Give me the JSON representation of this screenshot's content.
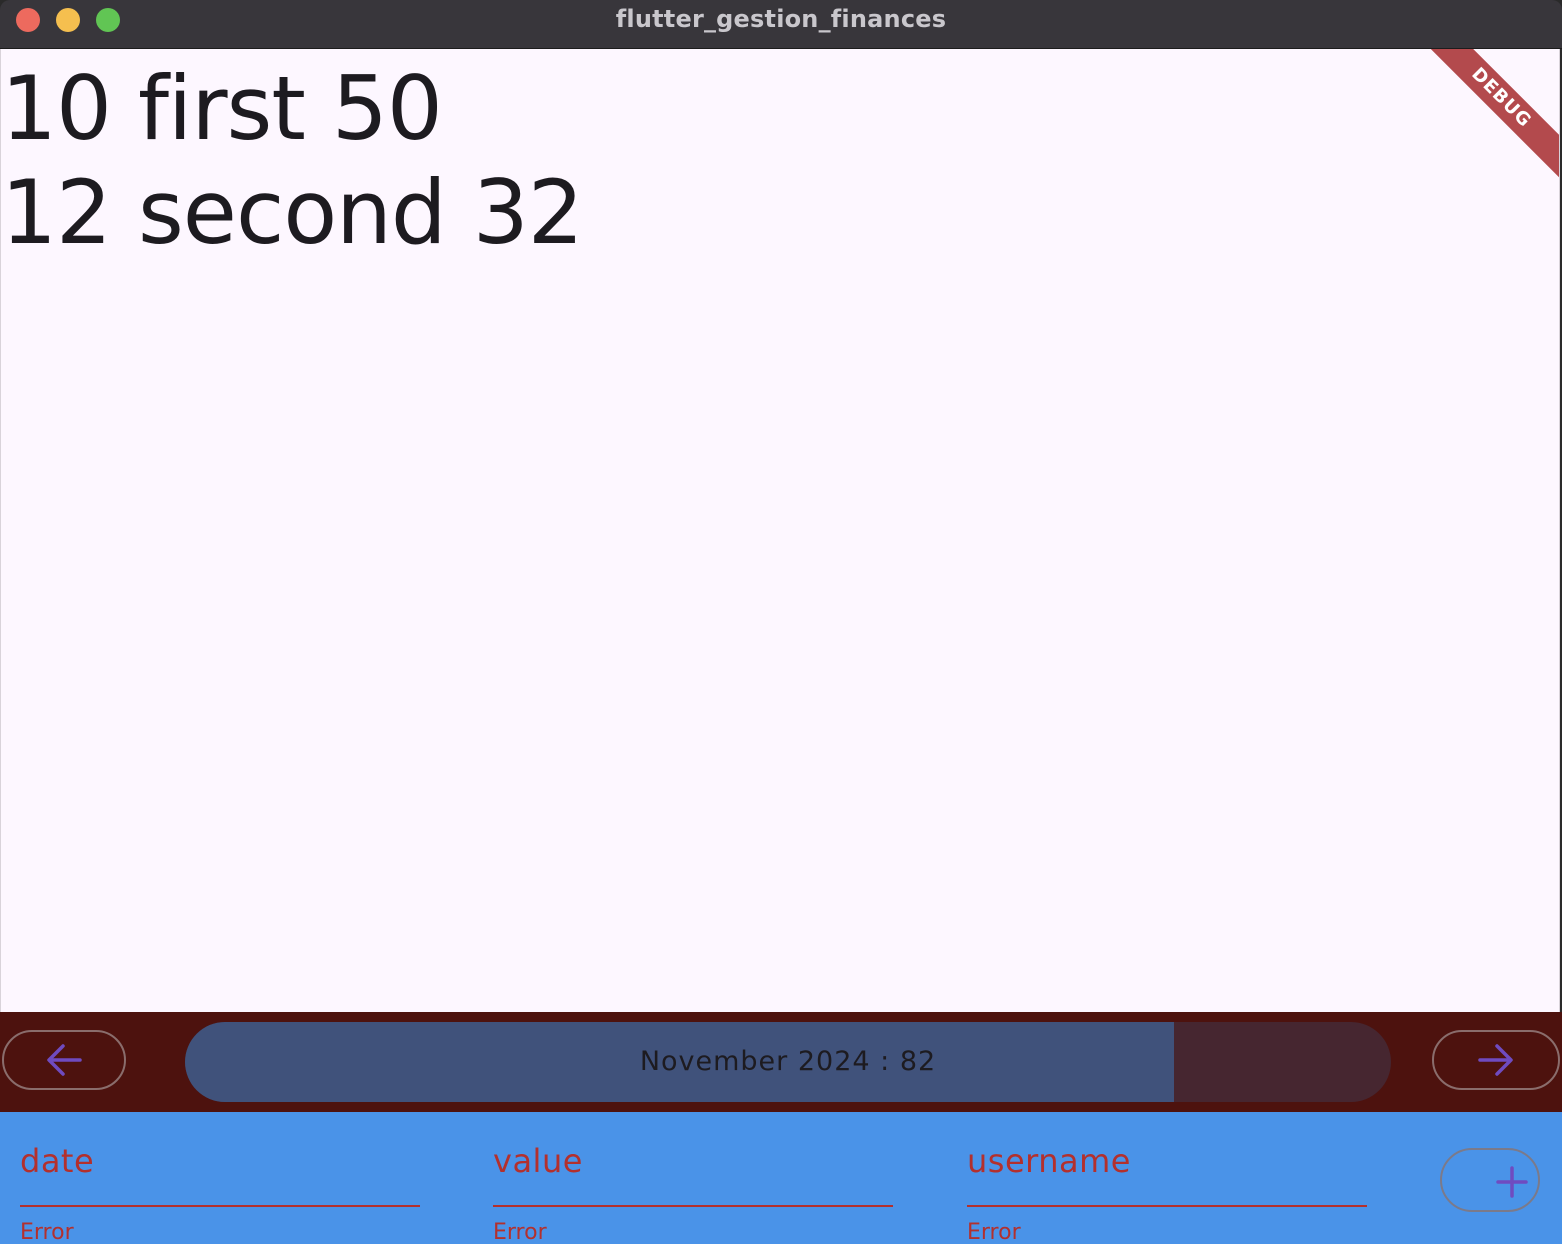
{
  "window": {
    "title": "flutter_gestion_finances"
  },
  "content": {
    "entries": [
      {
        "text": "10 first 50"
      },
      {
        "text": "12 second 32"
      }
    ],
    "debug_banner": "DEBUG"
  },
  "navigation": {
    "prev_icon": "arrow-left-icon",
    "next_icon": "arrow-right-icon",
    "progress_label": "November 2024 : 82",
    "progress_value": 0.82,
    "colors": {
      "bar_bg": "#4d120e",
      "progress_fill": "#40527b",
      "progress_track": "#462630",
      "icon": "#6f4bc0"
    }
  },
  "form": {
    "fields": [
      {
        "label": "date",
        "error": "Error"
      },
      {
        "label": "value",
        "error": "Error"
      },
      {
        "label": "username",
        "error": "Error"
      }
    ],
    "add_icon": "plus-icon",
    "colors": {
      "background": "#4a93e8",
      "label": "#b3302d"
    }
  }
}
